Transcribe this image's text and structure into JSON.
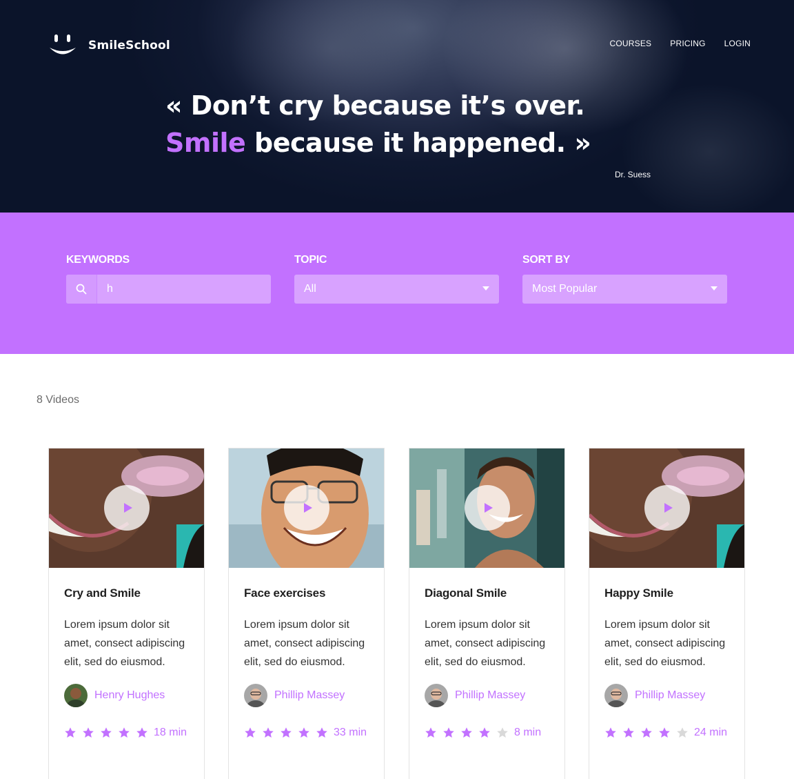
{
  "header": {
    "brand": "SmileSchool",
    "nav": [
      "COURSES",
      "PRICING",
      "LOGIN"
    ]
  },
  "hero": {
    "quote_line1": "« Don’t cry because it’s over.",
    "quote_accent": "Smile",
    "quote_line2_rest": " because it happened. »",
    "author": "Dr. Suess"
  },
  "filters": {
    "keywords_label": "KEYWORDS",
    "keywords_value": "h",
    "topic_label": "TOPIC",
    "topic_value": "All",
    "sort_label": "SORT BY",
    "sort_value": "Most Popular"
  },
  "results": {
    "count": "8 Videos",
    "cards": [
      {
        "title": "Cry and Smile",
        "desc": "Lorem ipsum dolor sit amet, consect adipiscing elit, sed do eiusmod.",
        "author": "Henry Hughes",
        "rating": 5,
        "duration": "18 min"
      },
      {
        "title": "Face exercises",
        "desc": "Lorem ipsum dolor sit amet, consect adipiscing elit, sed do eiusmod.",
        "author": "Phillip Massey",
        "rating": 5,
        "duration": "33 min"
      },
      {
        "title": "Diagonal Smile",
        "desc": "Lorem ipsum dolor sit amet, consect adipiscing elit, sed do eiusmod.",
        "author": "Phillip Massey",
        "rating": 4,
        "duration": "8 min"
      },
      {
        "title": "Happy Smile",
        "desc": "Lorem ipsum dolor sit amet, consect adipiscing elit, sed do eiusmod.",
        "author": "Phillip Massey",
        "rating": 4,
        "duration": "24 min"
      }
    ]
  },
  "colors": {
    "accent": "#c271ff",
    "accent_light": "#d8a2ff",
    "hero_bg": "#0b142a",
    "star_off": "#d9d9d9"
  },
  "icons": {
    "logo": "smile-face-icon",
    "search": "search-icon",
    "select_caret": "caret-down-icon",
    "play": "play-icon",
    "star": "star-icon"
  }
}
